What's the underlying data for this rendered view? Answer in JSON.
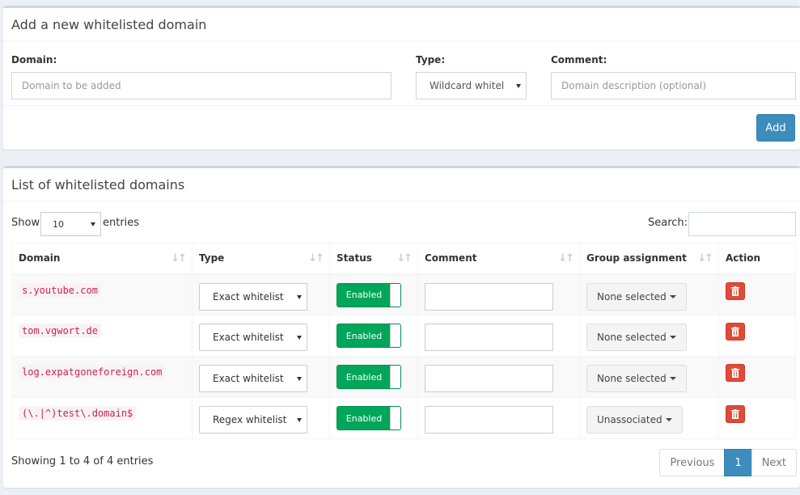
{
  "add_section": {
    "title": "Add a new whitelisted domain",
    "domain_label": "Domain:",
    "domain_placeholder": "Domain to be added",
    "type_label": "Type:",
    "type_value": "Wildcard whitel",
    "comment_label": "Comment:",
    "comment_placeholder": "Domain description (optional)",
    "add_button": "Add"
  },
  "list_section": {
    "title": "List of whitelisted domains",
    "show_label": "Show",
    "entries_label": "entries",
    "page_length": "10",
    "search_label": "Search:",
    "columns": [
      "Domain",
      "Type",
      "Status",
      "Comment",
      "Group assignment",
      "Action"
    ],
    "rows": [
      {
        "domain": "s.youtube.com",
        "type": "Exact whitelist",
        "status": "Enabled",
        "group": "None selected"
      },
      {
        "domain": "tom.vgwort.de",
        "type": "Exact whitelist",
        "status": "Enabled",
        "group": "None selected"
      },
      {
        "domain": "log.expatgoneforeign.com",
        "type": "Exact whitelist",
        "status": "Enabled",
        "group": "None selected"
      },
      {
        "domain": "(\\.|^)test\\.domain$",
        "type": "Regex whitelist",
        "status": "Enabled",
        "group": "Unassociated"
      }
    ],
    "info": "Showing 1 to 4 of 4 entries",
    "pagination": {
      "previous": "Previous",
      "page": "1",
      "next": "Next"
    }
  },
  "colors": {
    "primary": "#3c8dbc",
    "enabled": "#00a65a",
    "danger": "#dd4b39",
    "code": "#c7254e"
  }
}
